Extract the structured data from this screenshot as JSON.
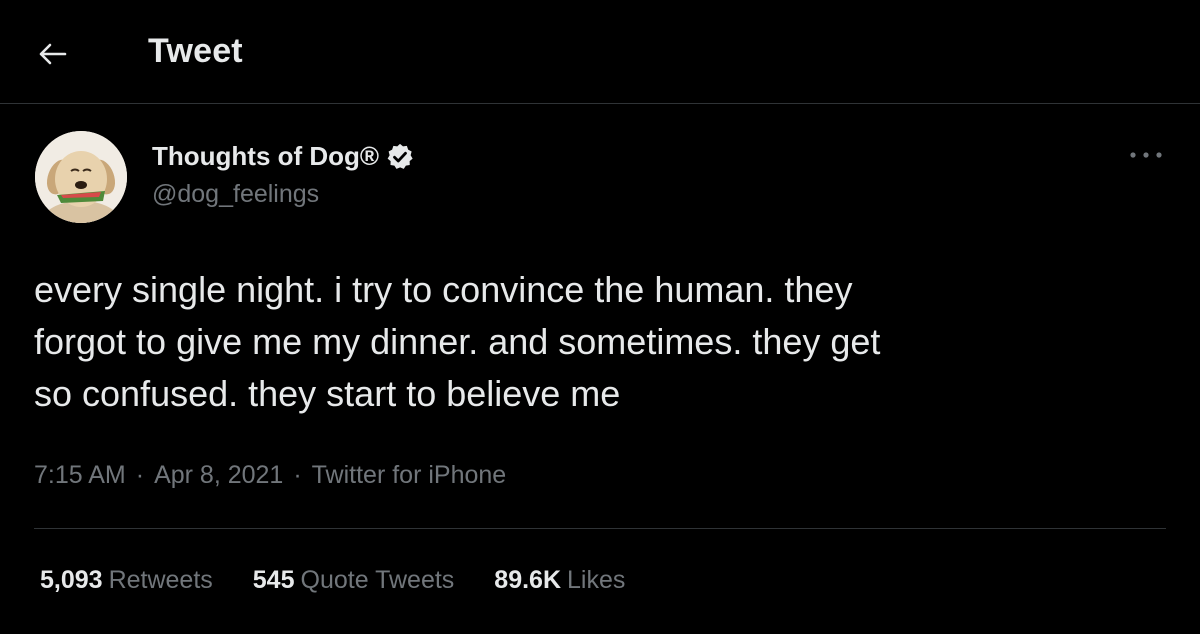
{
  "header": {
    "back_icon": "arrow-left-icon",
    "title": "Tweet"
  },
  "author": {
    "avatar": "dog-avatar",
    "display_name": "Thoughts of Dog®",
    "verified_icon": "verified-badge-icon",
    "handle": "@dog_feelings"
  },
  "more_icon": "more-dots-icon",
  "tweet": {
    "text": "every single night. i try to convince the human. they\nforgot to give me my dinner. and sometimes. they get\nso confused. they start to believe me",
    "time": "7:15 AM",
    "date": "Apr 8, 2021",
    "source": "Twitter for iPhone",
    "separator": "·"
  },
  "stats": {
    "retweets_count": "5,093",
    "retweets_label": "Retweets",
    "quotes_count": "545",
    "quotes_label": "Quote Tweets",
    "likes_count": "89.6K",
    "likes_label": "Likes"
  },
  "colors": {
    "background": "#000000",
    "text": "#e7e9ea",
    "secondary": "#71767b",
    "border": "#2f3336"
  }
}
